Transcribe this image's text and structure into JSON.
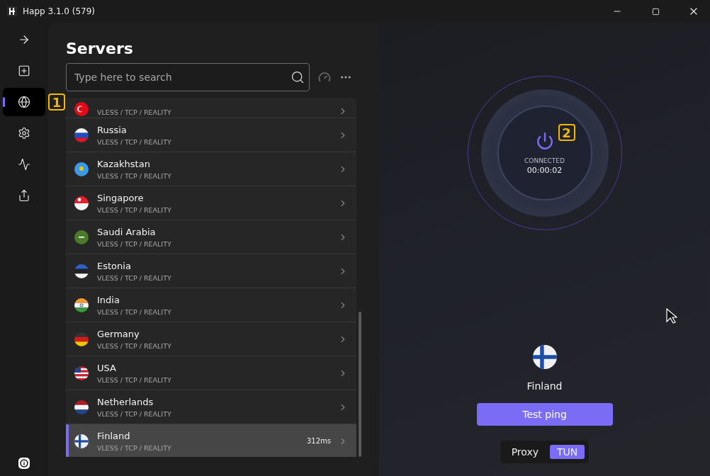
{
  "window": {
    "title": "Happ 3.1.0 (579)"
  },
  "nav": [
    {
      "selected": false
    },
    {
      "selected": false
    },
    {
      "selected": true
    },
    {
      "selected": false
    },
    {
      "selected": false
    },
    {
      "selected": false
    }
  ],
  "callouts": [
    "1",
    "2"
  ],
  "servers": {
    "title": "Servers",
    "search": {
      "placeholder": "Type here to search"
    },
    "items": [
      {
        "protocol": "VLESS / TCP / REALITY",
        "selected": false
      },
      {
        "name": "Russia",
        "protocol": "VLESS / TCP / REALITY",
        "selected": false
      },
      {
        "name": "Kazakhstan",
        "protocol": "VLESS / TCP / REALITY",
        "selected": false
      },
      {
        "name": "Singapore",
        "protocol": "VLESS / TCP / REALITY",
        "selected": false
      },
      {
        "name": "Saudi Arabia",
        "protocol": "VLESS / TCP / REALITY",
        "selected": false
      },
      {
        "name": "Estonia",
        "protocol": "VLESS / TCP / REALITY",
        "selected": false
      },
      {
        "name": "India",
        "protocol": "VLESS / TCP / REALITY",
        "selected": false
      },
      {
        "name": "Germany",
        "protocol": "VLESS / TCP / REALITY",
        "selected": false
      },
      {
        "name": "USA",
        "protocol": "VLESS / TCP / REALITY",
        "selected": false
      },
      {
        "name": "Netherlands",
        "protocol": "VLESS / TCP / REALITY",
        "selected": false
      },
      {
        "name": "Finland",
        "protocol": "VLESS / TCP / REALITY",
        "ping": "312ms",
        "selected": true
      }
    ]
  },
  "connection": {
    "status": "CONNECTED",
    "timer": "00:00:02",
    "country": "Finland",
    "test_button": "Test ping",
    "modes": [
      {
        "label": "Proxy",
        "selected": false
      },
      {
        "label": "TUN",
        "selected": true
      }
    ]
  }
}
